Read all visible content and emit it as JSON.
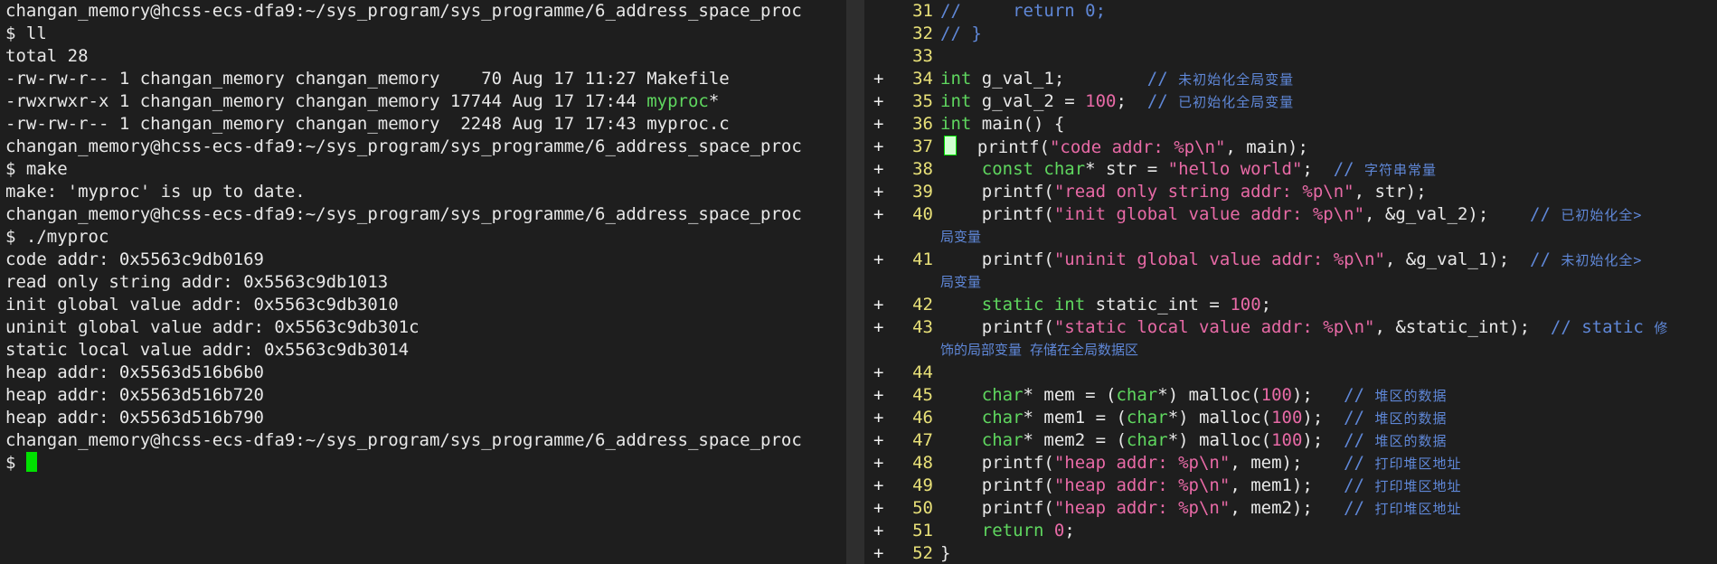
{
  "terminal": {
    "lines": [
      "changan_memory@hcss-ecs-dfa9:~/sys_program/sys_programme/6_address_space_proc",
      "$ ll",
      "total 28",
      "-rw-rw-r-- 1 changan_memory changan_memory    70 Aug 17 11:27 Makefile",
      "-rwxrwxr-x 1 changan_memory changan_memory 17744 Aug 17 17:44 ",
      "-rw-rw-r-- 1 changan_memory changan_memory  2248 Aug 17 17:43 myproc.c",
      "changan_memory@hcss-ecs-dfa9:~/sys_program/sys_programme/6_address_space_proc",
      "$ make",
      "make: 'myproc' is up to date.",
      "changan_memory@hcss-ecs-dfa9:~/sys_program/sys_programme/6_address_space_proc",
      "$ ./myproc",
      "code addr: 0x5563c9db0169",
      "read only string addr: 0x5563c9db1013",
      "init global value addr: 0x5563c9db3010",
      "uninit global value addr: 0x5563c9db301c",
      "static local value addr: 0x5563c9db3014",
      "heap addr: 0x5563d516b6b0",
      "heap addr: 0x5563d516b720",
      "heap addr: 0x5563d516b790",
      "changan_memory@hcss-ecs-dfa9:~/sys_program/sys_programme/6_address_space_proc"
    ],
    "exec_name": "myproc",
    "exec_suffix": "*",
    "prompt": "$ "
  },
  "editor": {
    "lines": [
      {
        "sign": "",
        "num": "31",
        "segs": [
          {
            "c": "cmt",
            "t": "//     "
          },
          {
            "c": "cmt",
            "t": "return 0;"
          }
        ]
      },
      {
        "sign": "",
        "num": "32",
        "segs": [
          {
            "c": "cmt",
            "t": "// }"
          }
        ]
      },
      {
        "sign": "",
        "num": "33",
        "segs": []
      },
      {
        "sign": "+",
        "num": "34",
        "segs": [
          {
            "c": "kw",
            "t": "int"
          },
          {
            "c": "",
            "t": " g_val_1;        "
          },
          {
            "c": "cmt",
            "t": "// "
          },
          {
            "c": "comment-zh",
            "t": "未初始化全局变量"
          }
        ]
      },
      {
        "sign": "+",
        "num": "35",
        "segs": [
          {
            "c": "kw",
            "t": "int"
          },
          {
            "c": "",
            "t": " g_val_2 = "
          },
          {
            "c": "num",
            "t": "100"
          },
          {
            "c": "",
            "t": ";  "
          },
          {
            "c": "cmt",
            "t": "// "
          },
          {
            "c": "comment-zh",
            "t": "已初始化全局变量"
          }
        ]
      },
      {
        "sign": "+",
        "num": "36",
        "segs": [
          {
            "c": "kw",
            "t": "int"
          },
          {
            "c": "",
            "t": " main() {"
          }
        ]
      },
      {
        "sign": "+",
        "num": "37",
        "cursor": true,
        "segs": [
          {
            "c": "",
            "t": "    printf("
          },
          {
            "c": "str",
            "t": "\"code addr: %p\\n\""
          },
          {
            "c": "",
            "t": ", main);"
          }
        ]
      },
      {
        "sign": "+",
        "num": "38",
        "segs": [
          {
            "c": "",
            "t": "    "
          },
          {
            "c": "kw",
            "t": "const char"
          },
          {
            "c": "",
            "t": "* str = "
          },
          {
            "c": "str",
            "t": "\"hello world\""
          },
          {
            "c": "",
            "t": ";  "
          },
          {
            "c": "cmt",
            "t": "// "
          },
          {
            "c": "comment-zh",
            "t": "字符串常量"
          }
        ]
      },
      {
        "sign": "+",
        "num": "39",
        "segs": [
          {
            "c": "",
            "t": "    printf("
          },
          {
            "c": "str",
            "t": "\"read only string addr: %p\\n\""
          },
          {
            "c": "",
            "t": ", str);"
          }
        ]
      },
      {
        "sign": "+",
        "num": "40",
        "segs": [
          {
            "c": "",
            "t": "    printf("
          },
          {
            "c": "str",
            "t": "\"init global value addr: %p\\n\""
          },
          {
            "c": "",
            "t": ", &g_val_2);    "
          },
          {
            "c": "cmt",
            "t": "// "
          },
          {
            "c": "comment-zh",
            "t": "已初始化全>"
          }
        ]
      },
      {
        "sign": "",
        "num": "",
        "cont": "局变量",
        "segs": []
      },
      {
        "sign": "+",
        "num": "41",
        "segs": [
          {
            "c": "",
            "t": "    printf("
          },
          {
            "c": "str",
            "t": "\"uninit global value addr: %p\\n\""
          },
          {
            "c": "",
            "t": ", &g_val_1);  "
          },
          {
            "c": "cmt",
            "t": "// "
          },
          {
            "c": "comment-zh",
            "t": "未初始化全>"
          }
        ]
      },
      {
        "sign": "",
        "num": "",
        "cont": "局变量",
        "segs": []
      },
      {
        "sign": "+",
        "num": "42",
        "segs": [
          {
            "c": "",
            "t": "    "
          },
          {
            "c": "kw",
            "t": "static int"
          },
          {
            "c": "",
            "t": " static_int = "
          },
          {
            "c": "num",
            "t": "100"
          },
          {
            "c": "",
            "t": ";"
          }
        ]
      },
      {
        "sign": "+",
        "num": "43",
        "segs": [
          {
            "c": "",
            "t": "    printf("
          },
          {
            "c": "str",
            "t": "\"static local value addr: %p\\n\""
          },
          {
            "c": "",
            "t": ", &static_int);  "
          },
          {
            "c": "cmt",
            "t": "// static "
          },
          {
            "c": "comment-zh",
            "t": "修"
          }
        ]
      },
      {
        "sign": "",
        "num": "",
        "cont": "饰的局部变量 存储在全局数据区",
        "segs": []
      },
      {
        "sign": "+",
        "num": "44",
        "segs": []
      },
      {
        "sign": "+",
        "num": "45",
        "segs": [
          {
            "c": "",
            "t": "    "
          },
          {
            "c": "kw",
            "t": "char"
          },
          {
            "c": "",
            "t": "* mem = ("
          },
          {
            "c": "kw",
            "t": "char"
          },
          {
            "c": "",
            "t": "*) malloc("
          },
          {
            "c": "num",
            "t": "100"
          },
          {
            "c": "",
            "t": ");   "
          },
          {
            "c": "cmt",
            "t": "// "
          },
          {
            "c": "comment-zh",
            "t": "堆区的数据"
          }
        ]
      },
      {
        "sign": "+",
        "num": "46",
        "segs": [
          {
            "c": "",
            "t": "    "
          },
          {
            "c": "kw",
            "t": "char"
          },
          {
            "c": "",
            "t": "* mem1 = ("
          },
          {
            "c": "kw",
            "t": "char"
          },
          {
            "c": "",
            "t": "*) malloc("
          },
          {
            "c": "num",
            "t": "100"
          },
          {
            "c": "",
            "t": ");  "
          },
          {
            "c": "cmt",
            "t": "// "
          },
          {
            "c": "comment-zh",
            "t": "堆区的数据"
          }
        ]
      },
      {
        "sign": "+",
        "num": "47",
        "segs": [
          {
            "c": "",
            "t": "    "
          },
          {
            "c": "kw",
            "t": "char"
          },
          {
            "c": "",
            "t": "* mem2 = ("
          },
          {
            "c": "kw",
            "t": "char"
          },
          {
            "c": "",
            "t": "*) malloc("
          },
          {
            "c": "num",
            "t": "100"
          },
          {
            "c": "",
            "t": ");  "
          },
          {
            "c": "cmt",
            "t": "// "
          },
          {
            "c": "comment-zh",
            "t": "堆区的数据"
          }
        ]
      },
      {
        "sign": "+",
        "num": "48",
        "segs": [
          {
            "c": "",
            "t": "    printf("
          },
          {
            "c": "str",
            "t": "\"heap addr: %p\\n\""
          },
          {
            "c": "",
            "t": ", mem);    "
          },
          {
            "c": "cmt",
            "t": "// "
          },
          {
            "c": "comment-zh",
            "t": "打印堆区地址"
          }
        ]
      },
      {
        "sign": "+",
        "num": "49",
        "segs": [
          {
            "c": "",
            "t": "    printf("
          },
          {
            "c": "str",
            "t": "\"heap addr: %p\\n\""
          },
          {
            "c": "",
            "t": ", mem1);   "
          },
          {
            "c": "cmt",
            "t": "// "
          },
          {
            "c": "comment-zh",
            "t": "打印堆区地址"
          }
        ]
      },
      {
        "sign": "+",
        "num": "50",
        "segs": [
          {
            "c": "",
            "t": "    printf("
          },
          {
            "c": "str",
            "t": "\"heap addr: %p\\n\""
          },
          {
            "c": "",
            "t": ", mem2);   "
          },
          {
            "c": "cmt",
            "t": "// "
          },
          {
            "c": "comment-zh",
            "t": "打印堆区地址"
          }
        ]
      },
      {
        "sign": "+",
        "num": "51",
        "segs": [
          {
            "c": "",
            "t": "    "
          },
          {
            "c": "kw",
            "t": "return"
          },
          {
            "c": "",
            "t": " "
          },
          {
            "c": "num",
            "t": "0"
          },
          {
            "c": "",
            "t": ";"
          }
        ]
      },
      {
        "sign": "+",
        "num": "52",
        "segs": [
          {
            "c": "",
            "t": "}"
          }
        ]
      }
    ]
  },
  "colors": {
    "background": "#1e1e1e",
    "keyword": "#5fd75f",
    "string": "#e86aa6",
    "comment": "#5f87d7",
    "line_number": "#e8e078",
    "cursor": "#00e000"
  }
}
